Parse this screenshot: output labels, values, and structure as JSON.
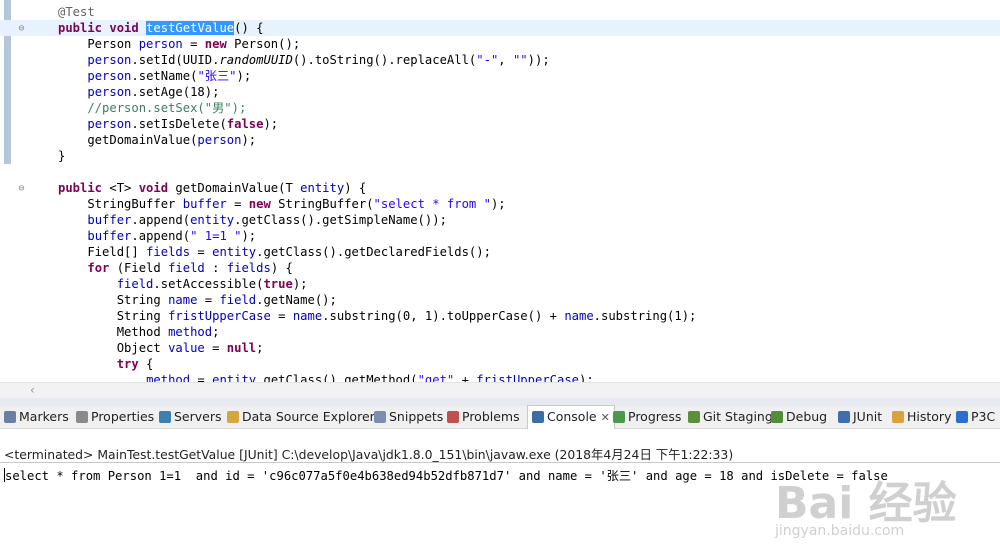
{
  "editor": {
    "lines": [
      [
        {
          "t": "@Test",
          "c": "ann"
        }
      ],
      [
        {
          "t": "public",
          "c": "kw"
        },
        {
          "t": " "
        },
        {
          "t": "void",
          "c": "kw"
        },
        {
          "t": " "
        },
        {
          "t": "testGetValue",
          "c": "sel"
        },
        {
          "t": "() {"
        }
      ],
      [
        {
          "t": "    Person "
        },
        {
          "t": "person",
          "c": "fld"
        },
        {
          "t": " = "
        },
        {
          "t": "new",
          "c": "kw"
        },
        {
          "t": " Person();"
        }
      ],
      [
        {
          "t": "    "
        },
        {
          "t": "person",
          "c": "fld"
        },
        {
          "t": ".setId(UUID."
        },
        {
          "t": "randomUUID",
          "c": "it"
        },
        {
          "t": "().toString().replaceAll("
        },
        {
          "t": "\"-\"",
          "c": "str"
        },
        {
          "t": ", "
        },
        {
          "t": "\"\"",
          "c": "str"
        },
        {
          "t": "));"
        }
      ],
      [
        {
          "t": "    "
        },
        {
          "t": "person",
          "c": "fld"
        },
        {
          "t": ".setName("
        },
        {
          "t": "\"张三\"",
          "c": "str"
        },
        {
          "t": ");"
        }
      ],
      [
        {
          "t": "    "
        },
        {
          "t": "person",
          "c": "fld"
        },
        {
          "t": ".setAge(18);"
        }
      ],
      [
        {
          "t": "    //person.setSex(\"男\");",
          "c": "cmt"
        }
      ],
      [
        {
          "t": "    "
        },
        {
          "t": "person",
          "c": "fld"
        },
        {
          "t": ".setIsDelete("
        },
        {
          "t": "false",
          "c": "kw"
        },
        {
          "t": ");"
        }
      ],
      [
        {
          "t": "    getDomainValue("
        },
        {
          "t": "person",
          "c": "fld"
        },
        {
          "t": ");"
        }
      ],
      [
        {
          "t": "}"
        }
      ],
      [],
      [
        {
          "t": "public",
          "c": "kw"
        },
        {
          "t": " <T> "
        },
        {
          "t": "void",
          "c": "kw"
        },
        {
          "t": " getDomainValue(T "
        },
        {
          "t": "entity",
          "c": "fld"
        },
        {
          "t": ") {"
        }
      ],
      [
        {
          "t": "    StringBuffer "
        },
        {
          "t": "buffer",
          "c": "fld"
        },
        {
          "t": " = "
        },
        {
          "t": "new",
          "c": "kw"
        },
        {
          "t": " StringBuffer("
        },
        {
          "t": "\"select * from \"",
          "c": "str"
        },
        {
          "t": ");"
        }
      ],
      [
        {
          "t": "    "
        },
        {
          "t": "buffer",
          "c": "fld"
        },
        {
          "t": ".append("
        },
        {
          "t": "entity",
          "c": "fld"
        },
        {
          "t": ".getClass().getSimpleName());"
        }
      ],
      [
        {
          "t": "    "
        },
        {
          "t": "buffer",
          "c": "fld"
        },
        {
          "t": ".append("
        },
        {
          "t": "\" 1=1 \"",
          "c": "str"
        },
        {
          "t": ");"
        }
      ],
      [
        {
          "t": "    Field[] "
        },
        {
          "t": "fields",
          "c": "fld"
        },
        {
          "t": " = "
        },
        {
          "t": "entity",
          "c": "fld"
        },
        {
          "t": ".getClass().getDeclaredFields();"
        }
      ],
      [
        {
          "t": "    "
        },
        {
          "t": "for",
          "c": "kw"
        },
        {
          "t": " (Field "
        },
        {
          "t": "field",
          "c": "fld"
        },
        {
          "t": " : "
        },
        {
          "t": "fields",
          "c": "fld"
        },
        {
          "t": ") {"
        }
      ],
      [
        {
          "t": "        "
        },
        {
          "t": "field",
          "c": "fld"
        },
        {
          "t": ".setAccessible("
        },
        {
          "t": "true",
          "c": "kw"
        },
        {
          "t": ");"
        }
      ],
      [
        {
          "t": "        String "
        },
        {
          "t": "name",
          "c": "fld"
        },
        {
          "t": " = "
        },
        {
          "t": "field",
          "c": "fld"
        },
        {
          "t": ".getName();"
        }
      ],
      [
        {
          "t": "        String "
        },
        {
          "t": "fristUpperCase",
          "c": "fld"
        },
        {
          "t": " = "
        },
        {
          "t": "name",
          "c": "fld"
        },
        {
          "t": ".substring(0, 1).toUpperCase() + "
        },
        {
          "t": "name",
          "c": "fld"
        },
        {
          "t": ".substring(1);"
        }
      ],
      [
        {
          "t": "        Method "
        },
        {
          "t": "method",
          "c": "fld"
        },
        {
          "t": ";"
        }
      ],
      [
        {
          "t": "        Object "
        },
        {
          "t": "value",
          "c": "fld"
        },
        {
          "t": " = "
        },
        {
          "t": "null",
          "c": "kw"
        },
        {
          "t": ";"
        }
      ],
      [
        {
          "t": "        "
        },
        {
          "t": "try",
          "c": "kw"
        },
        {
          "t": " {"
        }
      ],
      [
        {
          "t": "            "
        },
        {
          "t": "method",
          "c": "fld"
        },
        {
          "t": " = "
        },
        {
          "t": "entity",
          "c": "fld"
        },
        {
          "t": ".getClass().getMethod("
        },
        {
          "t": "\"get\"",
          "c": "str"
        },
        {
          "t": " + "
        },
        {
          "t": "fristUpperCase",
          "c": "fld"
        },
        {
          "t": ");"
        }
      ]
    ]
  },
  "tabs": [
    {
      "label": "Markers",
      "icon": "markers-icon",
      "color": "#6b7fa3"
    },
    {
      "label": "Properties",
      "icon": "properties-icon",
      "color": "#8a8a8a"
    },
    {
      "label": "Servers",
      "icon": "servers-icon",
      "color": "#3c7fb1"
    },
    {
      "label": "Data Source Explorer",
      "icon": "data-source-icon",
      "color": "#d4a73c"
    },
    {
      "label": "Snippets",
      "icon": "snippets-icon",
      "color": "#7a8fb0"
    },
    {
      "label": "Problems",
      "icon": "problems-icon",
      "color": "#c0504d"
    },
    {
      "label": "Console",
      "icon": "console-icon",
      "color": "#3a6ea5",
      "active": true
    },
    {
      "label": "Progress",
      "icon": "progress-icon",
      "color": "#4a9a4a"
    },
    {
      "label": "Git Staging",
      "icon": "git-staging-icon",
      "color": "#5a8f3c"
    },
    {
      "label": "Debug",
      "icon": "debug-icon",
      "color": "#4f8f3a"
    },
    {
      "label": "JUnit",
      "icon": "junit-icon",
      "color": "#3d6fb0"
    },
    {
      "label": "History",
      "icon": "history-icon",
      "color": "#d9a23a"
    },
    {
      "label": "P3C",
      "icon": "p3c-icon",
      "color": "#2b6fd1"
    }
  ],
  "console": {
    "terminated": "<terminated> MainTest.testGetValue [JUnit] C:\\develop\\Java\\jdk1.8.0_151\\bin\\javaw.exe (2018年4月24日 下午1:22:33)",
    "output": "select * from Person 1=1  and id = 'c96c077a5f0e4b638ed94b52dfb871d7' and name = '张三' and age = 18 and isDelete = false"
  },
  "watermark": {
    "logo": "Bai 经验",
    "url": "jingyan.baidu.com"
  }
}
